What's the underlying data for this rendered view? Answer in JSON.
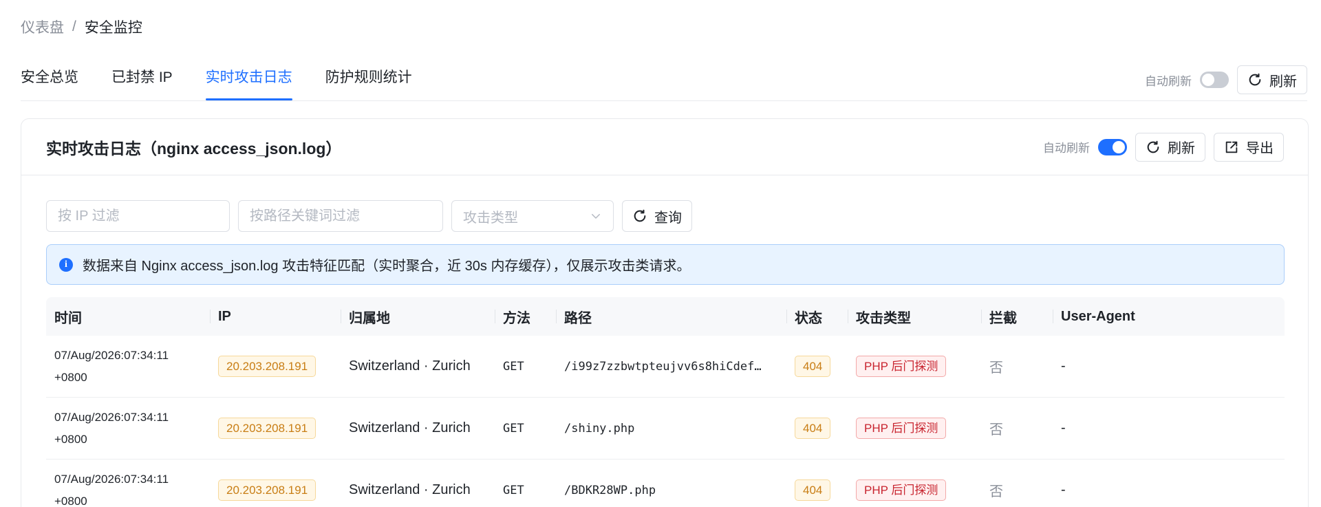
{
  "breadcrumb": {
    "root": "仪表盘",
    "separator": "/",
    "current": "安全监控"
  },
  "tabs": [
    {
      "label": "安全总览",
      "active": false
    },
    {
      "label": "已封禁 IP",
      "active": false
    },
    {
      "label": "实时攻击日志",
      "active": true
    },
    {
      "label": "防护规则统计",
      "active": false
    }
  ],
  "top_toolbar": {
    "auto_refresh_label": "自动刷新",
    "auto_refresh_on": false,
    "refresh_label": "刷新"
  },
  "card": {
    "title": "实时攻击日志（nginx access_json.log）",
    "auto_refresh_label": "自动刷新",
    "auto_refresh_on": true,
    "refresh_label": "刷新",
    "export_label": "导出"
  },
  "filters": {
    "ip_placeholder": "按 IP 过滤",
    "path_placeholder": "按路径关键词过滤",
    "type_placeholder": "攻击类型",
    "query_label": "查询"
  },
  "alert": {
    "text": "数据来自 Nginx access_json.log 攻击特征匹配（实时聚合，近 30s 内存缓存），仅展示攻击类请求。"
  },
  "table": {
    "headers": [
      "时间",
      "IP",
      "归属地",
      "方法",
      "路径",
      "状态",
      "攻击类型",
      "拦截",
      "User-Agent"
    ],
    "rows": [
      {
        "time_date": "07/Aug/2026:07:34:11",
        "time_tz": "+0800",
        "ip": "20.203.208.191",
        "location": "Switzerland · Zurich",
        "method": "GET",
        "path": "/i99z7zzbwtpteujvv6s8hiCdef…",
        "status": "404",
        "attack": "PHP 后门探测",
        "blocked": "否",
        "ua": "-"
      },
      {
        "time_date": "07/Aug/2026:07:34:11",
        "time_tz": "+0800",
        "ip": "20.203.208.191",
        "location": "Switzerland · Zurich",
        "method": "GET",
        "path": "/shiny.php",
        "status": "404",
        "attack": "PHP 后门探测",
        "blocked": "否",
        "ua": "-"
      },
      {
        "time_date": "07/Aug/2026:07:34:11",
        "time_tz": "+0800",
        "ip": "20.203.208.191",
        "location": "Switzerland · Zurich",
        "method": "GET",
        "path": "/BDKR28WP.php",
        "status": "404",
        "attack": "PHP 后门探测",
        "blocked": "否",
        "ua": "-"
      }
    ]
  },
  "colors": {
    "accent": "#1e6fff",
    "warning": "#c87d14",
    "danger": "#c8242f"
  },
  "icons": {
    "refresh": "refresh-icon",
    "export": "export-icon",
    "info": "info-icon",
    "dropdown": "chevron-down-icon"
  }
}
